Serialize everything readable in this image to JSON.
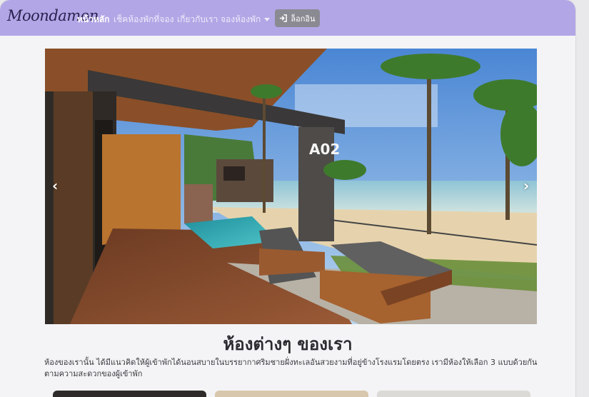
{
  "brand": {
    "name": "Moondamon"
  },
  "nav": {
    "items": [
      {
        "label": "หน้าหลัก"
      },
      {
        "label": "เช็คห้องพักที่จอง"
      },
      {
        "label": "เกี่ยวกับเรา"
      },
      {
        "label": "จองห้องพัก"
      }
    ],
    "login_label": "ล็อกอิน",
    "login_icon": "sign-in-icon"
  },
  "hero": {
    "sign_text": "A02",
    "prev_icon": "chevron-left-icon",
    "next_icon": "chevron-right-icon"
  },
  "rooms_section": {
    "title": "ห้องต่างๆ ของเรา",
    "description": "ห้องของเรานั้น ได้มีแนวคิดให้ผู้เข้าพักได้นอนสบายในบรรยากาศริมชายฝั่งทะเลอันสวยงามที่อยู่ข้างโรงแรมโดยตรง เรามีห้องให้เลือก 3 แบบด้วยกัน ตามความสะดวกของผู้เข้าพัก"
  },
  "colors": {
    "navbar": "#b3a6e6",
    "login_button": "#8a8a92"
  }
}
